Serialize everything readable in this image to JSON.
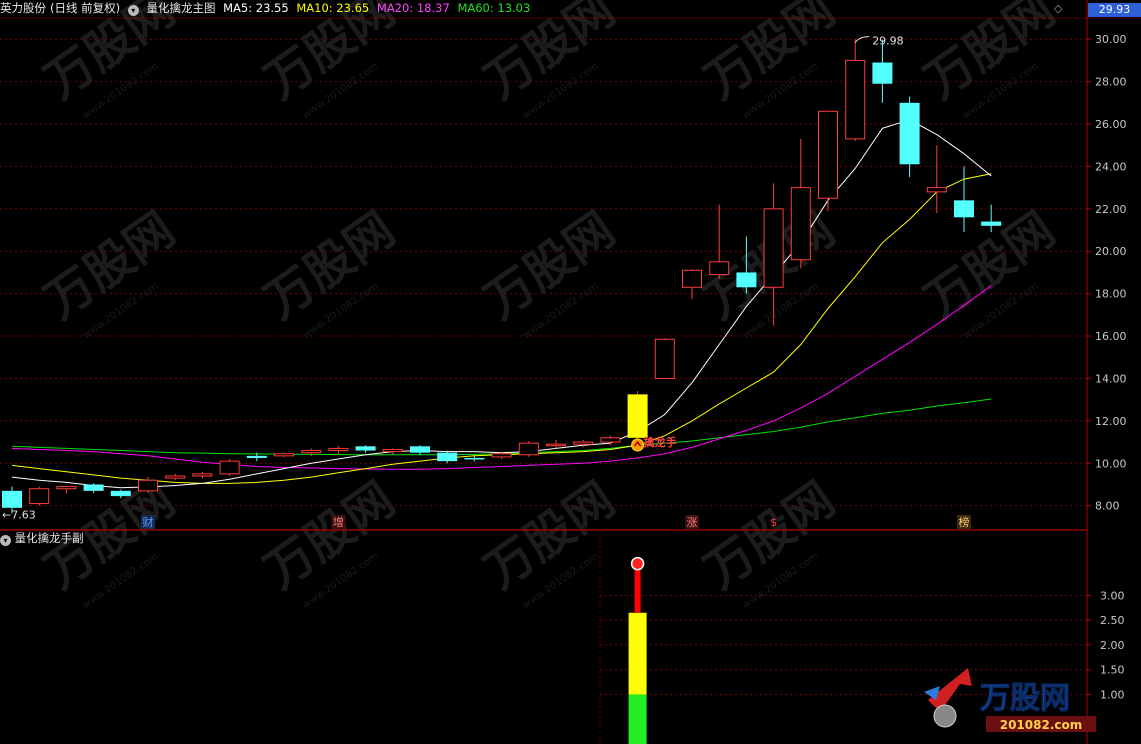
{
  "header": {
    "stock": "英力股份",
    "period": "(日线 前复权)",
    "indicator": "量化擒龙主图",
    "ma5_label": "MA5:",
    "ma5_value": "23.55",
    "ma10_label": "MA10:",
    "ma10_value": "23.65",
    "ma20_label": "MA20:",
    "ma20_value": "18.37",
    "ma60_label": "MA60:",
    "ma60_value": "13.03",
    "collapse_icon": "chevron-down-icon"
  },
  "current_price": "29.93",
  "sub_panel_title": "量化擒龙手副",
  "colors": {
    "background": "#000000",
    "up": "#ff3b3b",
    "down": "#54ffff",
    "ma5": "#ffffff",
    "ma10": "#ffff00",
    "ma20": "#ff00ff",
    "ma60": "#00e000",
    "grid": "#7a0000",
    "axis": "#b00000"
  },
  "chart_data": [
    {
      "type": "candlestick",
      "title": "量化擒龙主图",
      "ylim": [
        6.9,
        31.0
      ],
      "y_ticks": [
        "8.00",
        "10.00",
        "12.00",
        "14.00",
        "16.00",
        "18.00",
        "20.00",
        "22.00",
        "24.00",
        "26.00",
        "28.00",
        "30.00"
      ],
      "y_tick_values": [
        8,
        10,
        12,
        14,
        16,
        18,
        20,
        22,
        24,
        26,
        28,
        30
      ],
      "candles": [
        {
          "o": 8.7,
          "h": 8.9,
          "l": 7.63,
          "c": 7.9
        },
        {
          "o": 8.1,
          "h": 8.9,
          "l": 8.0,
          "c": 8.8
        },
        {
          "o": 8.8,
          "h": 8.95,
          "l": 8.6,
          "c": 8.9
        },
        {
          "o": 9.0,
          "h": 9.05,
          "l": 8.6,
          "c": 8.7
        },
        {
          "o": 8.7,
          "h": 8.75,
          "l": 8.35,
          "c": 8.45
        },
        {
          "o": 8.7,
          "h": 9.35,
          "l": 8.6,
          "c": 9.2
        },
        {
          "o": 9.3,
          "h": 9.5,
          "l": 9.2,
          "c": 9.4
        },
        {
          "o": 9.4,
          "h": 9.6,
          "l": 9.3,
          "c": 9.5
        },
        {
          "o": 9.5,
          "h": 10.2,
          "l": 9.4,
          "c": 10.1
        },
        {
          "o": 10.35,
          "h": 10.5,
          "l": 10.1,
          "c": 10.25
        },
        {
          "o": 10.35,
          "h": 10.5,
          "l": 10.3,
          "c": 10.45
        },
        {
          "o": 10.5,
          "h": 10.7,
          "l": 10.35,
          "c": 10.6
        },
        {
          "o": 10.6,
          "h": 10.8,
          "l": 10.45,
          "c": 10.7
        },
        {
          "o": 10.8,
          "h": 10.85,
          "l": 10.5,
          "c": 10.6
        },
        {
          "o": 10.55,
          "h": 10.7,
          "l": 10.4,
          "c": 10.65
        },
        {
          "o": 10.8,
          "h": 10.85,
          "l": 10.4,
          "c": 10.5
        },
        {
          "o": 10.5,
          "h": 10.6,
          "l": 10.0,
          "c": 10.1
        },
        {
          "o": 10.25,
          "h": 10.4,
          "l": 10.1,
          "c": 10.2
        },
        {
          "o": 10.3,
          "h": 10.55,
          "l": 10.2,
          "c": 10.45
        },
        {
          "o": 10.4,
          "h": 11.05,
          "l": 10.3,
          "c": 10.95
        },
        {
          "o": 10.9,
          "h": 11.1,
          "l": 10.7,
          "c": 10.9
        },
        {
          "o": 10.9,
          "h": 11.1,
          "l": 10.75,
          "c": 11.0
        },
        {
          "o": 11.0,
          "h": 11.3,
          "l": 10.85,
          "c": 11.2
        },
        {
          "o": 11.2,
          "h": 13.4,
          "l": 11.15,
          "c": 13.25
        },
        {
          "o": 14.0,
          "h": 15.9,
          "l": 14.0,
          "c": 15.85
        },
        {
          "o": 18.3,
          "h": 19.15,
          "l": 17.75,
          "c": 19.1
        },
        {
          "o": 18.9,
          "h": 22.2,
          "l": 18.7,
          "c": 19.5
        },
        {
          "o": 19.0,
          "h": 20.7,
          "l": 18.0,
          "c": 18.3
        },
        {
          "o": 18.3,
          "h": 23.2,
          "l": 16.5,
          "c": 22.0
        },
        {
          "o": 19.6,
          "h": 25.3,
          "l": 19.2,
          "c": 23.0
        },
        {
          "o": 22.5,
          "h": 26.6,
          "l": 21.9,
          "c": 26.6
        },
        {
          "o": 25.3,
          "h": 30.0,
          "l": 25.2,
          "c": 29.0
        },
        {
          "o": 28.9,
          "h": 29.98,
          "l": 27.0,
          "c": 27.9
        },
        {
          "o": 27.0,
          "h": 27.3,
          "l": 23.5,
          "c": 24.1
        },
        {
          "o": 22.8,
          "h": 25.0,
          "l": 21.8,
          "c": 23.0
        },
        {
          "o": 22.4,
          "h": 24.0,
          "l": 20.9,
          "c": 21.6
        },
        {
          "o": 21.4,
          "h": 22.2,
          "l": 20.9,
          "c": 21.2
        }
      ],
      "ma5": [
        9.35,
        9.2,
        9.1,
        8.95,
        8.85,
        8.88,
        8.95,
        9.05,
        9.25,
        9.5,
        9.75,
        10.0,
        10.2,
        10.4,
        10.55,
        10.6,
        10.55,
        10.55,
        10.5,
        10.55,
        10.7,
        10.85,
        10.95,
        11.5,
        12.3,
        13.8,
        15.6,
        17.4,
        18.9,
        20.4,
        22.4,
        23.9,
        25.8,
        26.2,
        25.5,
        24.6,
        23.55
      ],
      "ma10": [
        9.9,
        9.75,
        9.6,
        9.45,
        9.3,
        9.2,
        9.1,
        9.05,
        9.05,
        9.1,
        9.2,
        9.35,
        9.55,
        9.75,
        9.95,
        10.1,
        10.25,
        10.35,
        10.4,
        10.45,
        10.5,
        10.55,
        10.65,
        10.85,
        11.3,
        12.0,
        12.8,
        13.55,
        14.3,
        15.6,
        17.3,
        18.8,
        20.4,
        21.5,
        22.8,
        23.4,
        23.65
      ],
      "ma20": [
        10.7,
        10.65,
        10.6,
        10.55,
        10.45,
        10.35,
        10.2,
        10.05,
        9.95,
        9.85,
        9.8,
        9.78,
        9.75,
        9.73,
        9.72,
        9.72,
        9.75,
        9.8,
        9.85,
        9.9,
        9.95,
        10.0,
        10.1,
        10.25,
        10.45,
        10.75,
        11.15,
        11.55,
        12.0,
        12.6,
        13.3,
        14.1,
        14.9,
        15.7,
        16.55,
        17.45,
        18.37
      ],
      "ma60": [
        10.8,
        10.75,
        10.7,
        10.65,
        10.6,
        10.55,
        10.5,
        10.48,
        10.45,
        10.44,
        10.43,
        10.42,
        10.41,
        10.4,
        10.4,
        10.4,
        10.4,
        10.42,
        10.45,
        10.5,
        10.55,
        10.6,
        10.7,
        10.85,
        10.95,
        11.05,
        11.2,
        11.35,
        11.5,
        11.7,
        11.95,
        12.15,
        12.35,
        12.5,
        12.7,
        12.85,
        13.03
      ],
      "annotations": [
        {
          "text": "←7.63",
          "value": 7.63
        },
        {
          "text": "29.98",
          "value": 29.98
        },
        {
          "text": "擒龙手",
          "value": 11.05
        }
      ],
      "event_markers": [
        "财",
        "增",
        "涨",
        "$",
        "榜"
      ]
    },
    {
      "type": "bar",
      "title": "量化擒龙手副",
      "ylim": [
        0,
        4.3
      ],
      "y_ticks": [
        "1.00",
        "1.50",
        "2.00",
        "2.50",
        "3.00"
      ],
      "y_tick_values": [
        1.0,
        1.5,
        2.0,
        2.5,
        3.0
      ],
      "bar": {
        "green_top": 1.0,
        "yellow_top": 2.65,
        "red_top": 3.6
      }
    }
  ],
  "watermark": {
    "brand": "万股网",
    "url": "www.201082.com",
    "logo_text": "201082.com"
  }
}
